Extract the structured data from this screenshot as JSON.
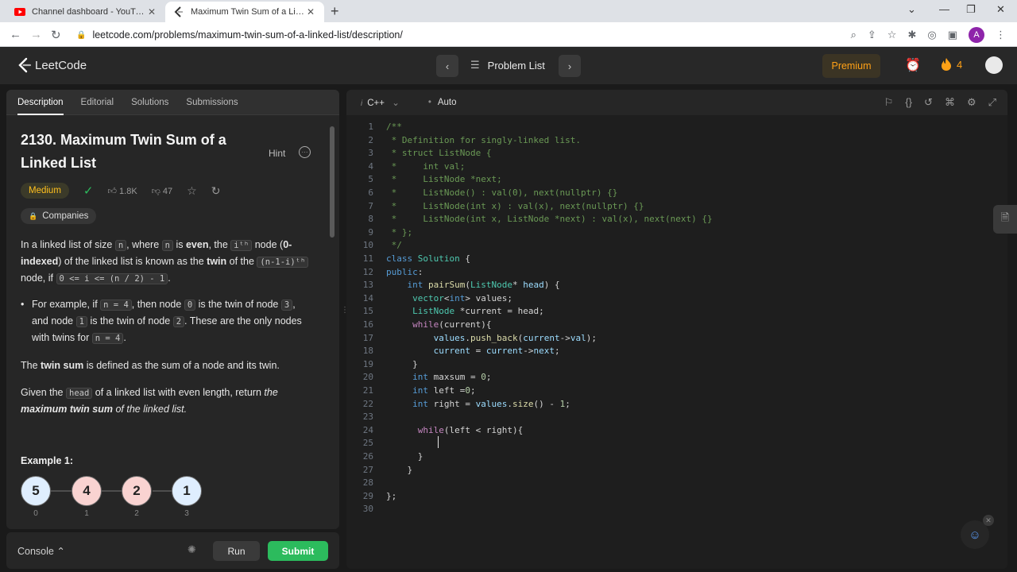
{
  "browser": {
    "tabs": [
      {
        "title": "Channel dashboard - YouTube Studio"
      },
      {
        "title": "Maximum Twin Sum of a Linked List"
      }
    ],
    "url": "leetcode.com/problems/maximum-twin-sum-of-a-linked-list/description/",
    "profile_letter": "A"
  },
  "nav": {
    "logo": "LeetCode",
    "problem_list": "Problem List",
    "premium": "Premium",
    "streak": "4"
  },
  "left": {
    "tabs": [
      "Description",
      "Editorial",
      "Solutions",
      "Submissions"
    ],
    "title": "2130. Maximum Twin Sum of a Linked List",
    "hint": "Hint",
    "difficulty": "Medium",
    "likes": "1.8K",
    "dislikes": "47",
    "companies": "Companies",
    "desc_1": "In a linked list of size",
    "desc_2": "where",
    "desc_3": "is",
    "desc_even": "even",
    "desc_4": ", the",
    "desc_5": "node (",
    "desc_6": "0-indexed",
    "desc_7": ") of the linked list is known as the",
    "desc_twin": "twin",
    "desc_8": "of the",
    "desc_9": "node, if",
    "bullet_1": "For example, if",
    "bullet_2": ", then node",
    "bullet_3": "is the twin of node",
    "bullet_4": ", and node",
    "bullet_5": "is the twin of node",
    "bullet_6": ". These are the only nodes with twins for",
    "twin_sum_1": "The",
    "twin_sum_b": "twin sum",
    "twin_sum_2": "is defined as the sum of a node and its twin.",
    "given_1": "Given the",
    "given_2": "of a linked list with even length, return",
    "given_3": "the",
    "given_b": "maximum twin sum",
    "given_4": "of the linked list.",
    "example": "Example 1:",
    "code_n": "n",
    "code_ith": "iᵗʰ",
    "code_n1i": "(n-1-i)ᵗʰ",
    "code_cond": "0 <= i <= (n / 2) - 1",
    "code_n4": "n = 4",
    "code_0": "0",
    "code_3": "3",
    "code_1": "1",
    "code_2": "2",
    "code_head": "head",
    "nodes": [
      {
        "value": "5",
        "index": "0",
        "color": "#dfeefe"
      },
      {
        "value": "4",
        "index": "1",
        "color": "#f9d3d1"
      },
      {
        "value": "2",
        "index": "2",
        "color": "#f9d3d1"
      },
      {
        "value": "1",
        "index": "3",
        "color": "#dfeefe"
      }
    ]
  },
  "bottom": {
    "console": "Console",
    "run": "Run",
    "submit": "Submit"
  },
  "editor": {
    "language": "C++",
    "mode": "Auto",
    "line_numbers": [
      "1",
      "2",
      "3",
      "4",
      "5",
      "6",
      "7",
      "8",
      "9",
      "10",
      "11",
      "12",
      "13",
      "14",
      "15",
      "16",
      "17",
      "18",
      "19",
      "20",
      "21",
      "22",
      "23",
      "24",
      "25",
      "26",
      "27",
      "28",
      "29",
      "30"
    ]
  }
}
